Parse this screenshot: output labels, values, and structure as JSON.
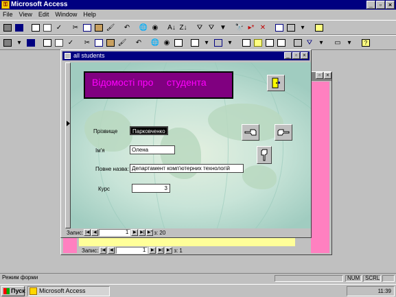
{
  "app": {
    "title": "Microsoft Access"
  },
  "menu": [
    "File",
    "View",
    "Edit",
    "Window",
    "Help"
  ],
  "child_window": {
    "nav": {
      "label": "Запис:",
      "record": "1",
      "of": "з: 1"
    }
  },
  "form_window": {
    "title": "all students",
    "header": "Відомості про     студента",
    "fields": {
      "surname": {
        "label": "Прізвище",
        "value": "Парковченко"
      },
      "name": {
        "label": "Ім'я",
        "value": "Олена"
      },
      "department": {
        "label": "Повне назва:",
        "value": "Департамент комп'ютерних технологій"
      },
      "course": {
        "label": "Курс",
        "value": "3"
      }
    },
    "nav": {
      "label": "Запис:",
      "record": "1",
      "of": "з: 20"
    }
  },
  "status": {
    "text": "Режим форми",
    "num": "NUM",
    "scrl": "SCRL"
  },
  "taskbar": {
    "start": "Пуск",
    "app": "Microsoft Access",
    "time": "11:39"
  },
  "colors": {
    "titlebar": "#000080",
    "header_bg": "#800080",
    "header_text": "#ff00ff",
    "pink": "#ff80c0",
    "yellow": "#ffff99"
  }
}
